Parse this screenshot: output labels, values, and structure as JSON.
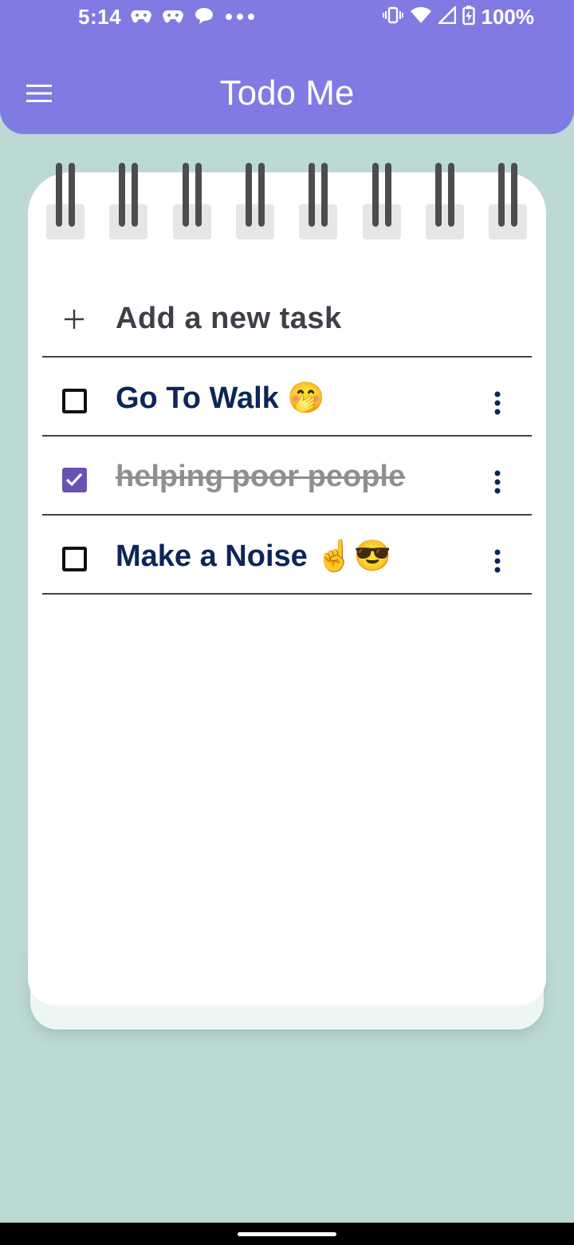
{
  "status_bar": {
    "time": "5:14",
    "battery": "100%",
    "left_icons": [
      "gamepad-icon",
      "gamepad-icon",
      "chat-bubble-icon",
      "more-dots-icon"
    ],
    "right_icons": [
      "vibrate-icon",
      "wifi-icon",
      "signal-icon",
      "battery-charging-icon"
    ]
  },
  "app_bar": {
    "title": "Todo Me",
    "menu_icon": "hamburger-menu-icon",
    "background": "#7f7be2"
  },
  "notebook": {
    "ring_count": 8,
    "add_task": {
      "label": "Add a new task",
      "icon": "plus-icon"
    },
    "tasks": [
      {
        "title": "Go To Walk 🤭",
        "done": false
      },
      {
        "title": "helping poor people",
        "done": true
      },
      {
        "title": "Make a Noise ☝️😎",
        "done": false
      }
    ]
  },
  "colors": {
    "background": "#bcd9d3",
    "task_text": "#0b2657",
    "done_text": "#8f8f8f",
    "checkbox_checked": "#6a52b2"
  }
}
